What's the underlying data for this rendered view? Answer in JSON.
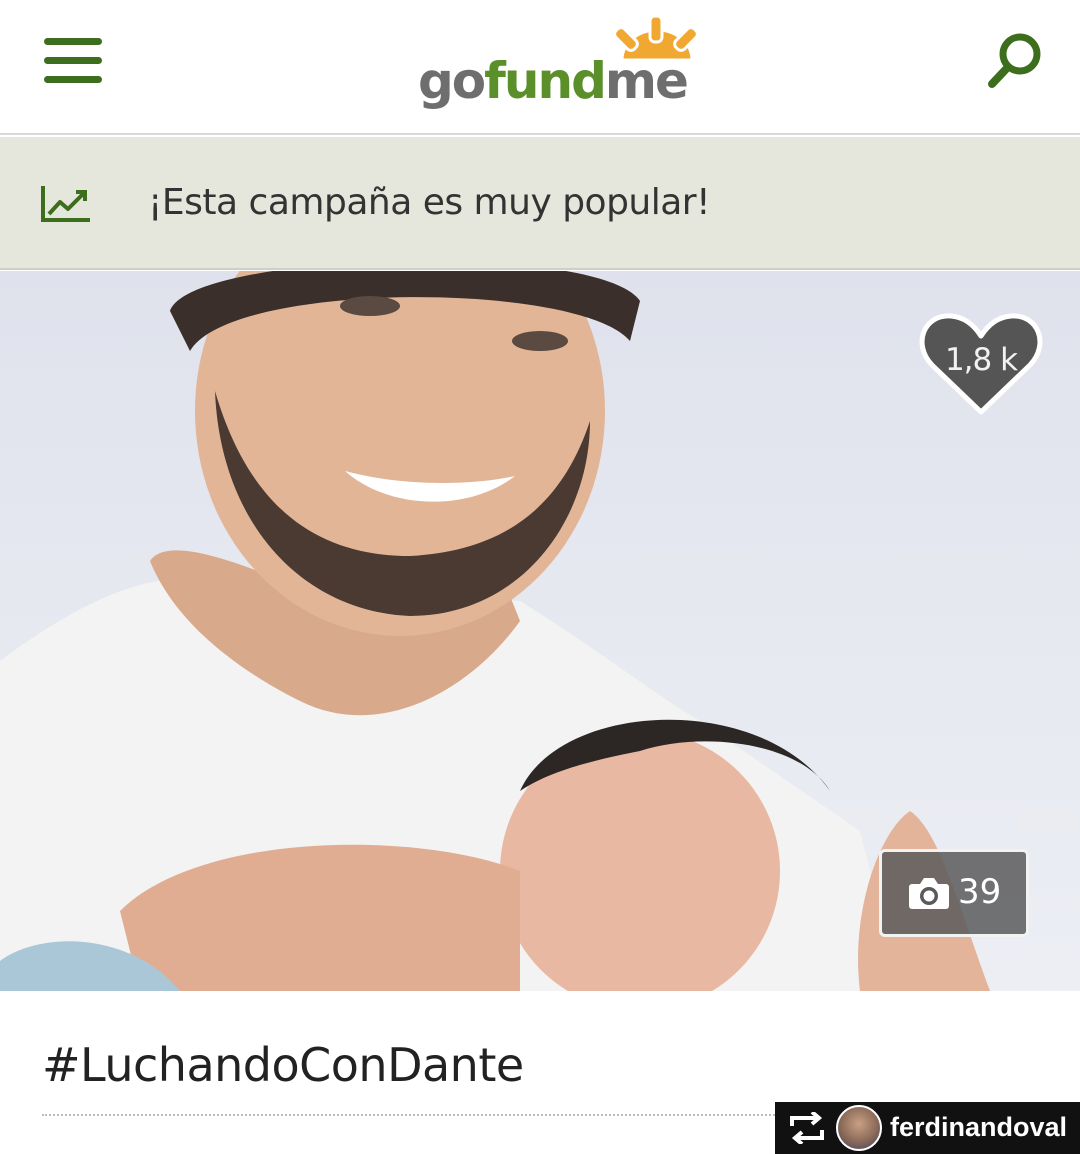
{
  "header": {
    "logo": {
      "part1": "go",
      "part2": "fund",
      "part3": "me"
    },
    "brand_green": "#5a8f2a",
    "icons": {
      "menu": "hamburger-icon",
      "search": "magnifier-icon"
    }
  },
  "banner": {
    "text": "¡Esta campaña es muy popular!",
    "icon": "trending-up-icon",
    "background": "#e6e7dc"
  },
  "photo": {
    "likes": "1,8 k",
    "gallery_count": "39",
    "icons": {
      "likes": "heart-icon",
      "gallery": "camera-icon"
    }
  },
  "campaign": {
    "title": "#LuchandoConDante"
  },
  "repost": {
    "username": "ferdinandoval",
    "icon": "repost-icon"
  }
}
